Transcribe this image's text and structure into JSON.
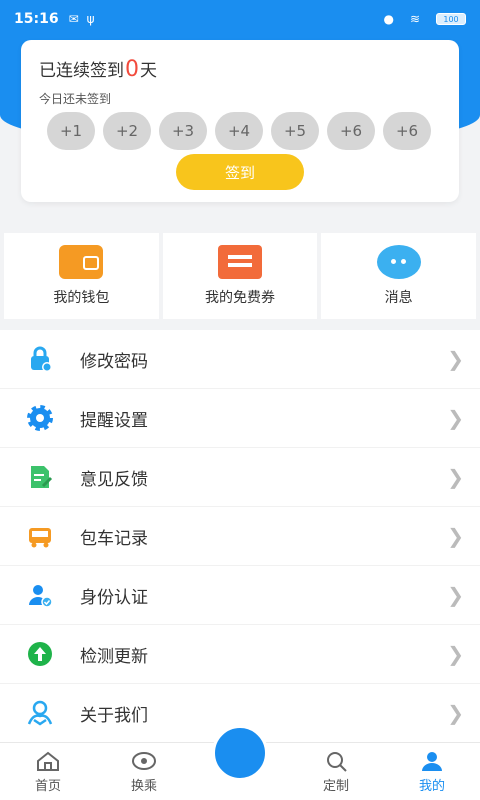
{
  "status_bar": {
    "time": "15:16",
    "battery": "100"
  },
  "sign_in": {
    "title_prefix": "已连续签到",
    "days": "0",
    "title_suffix": "天",
    "subtitle": "今日还未签到",
    "day_rewards": [
      "+1",
      "+2",
      "+3",
      "+4",
      "+5",
      "+6",
      "+6"
    ],
    "button_label": "签到"
  },
  "quick_actions": [
    {
      "label": "我的钱包",
      "icon": "wallet-icon"
    },
    {
      "label": "我的免费券",
      "icon": "coupon-icon"
    },
    {
      "label": "消息",
      "icon": "message-icon"
    }
  ],
  "menu": [
    {
      "label": "修改密码",
      "icon": "lock-icon"
    },
    {
      "label": "提醒设置",
      "icon": "gear-icon"
    },
    {
      "label": "意见反馈",
      "icon": "feedback-icon"
    },
    {
      "label": "包车记录",
      "icon": "bus-icon"
    },
    {
      "label": "身份认证",
      "icon": "user-verify-icon"
    },
    {
      "label": "检测更新",
      "icon": "upload-icon"
    },
    {
      "label": "关于我们",
      "icon": "about-icon"
    }
  ],
  "tabs": [
    {
      "label": "首页",
      "icon": "home-icon"
    },
    {
      "label": "换乘",
      "icon": "transfer-icon"
    },
    {
      "label": "",
      "icon": "center-icon"
    },
    {
      "label": "定制",
      "icon": "custom-icon"
    },
    {
      "label": "我的",
      "icon": "profile-icon"
    }
  ],
  "colors": {
    "primary": "#1a8ef0",
    "sign_button": "#f8c51c",
    "days_highlight": "#f24b3d"
  }
}
